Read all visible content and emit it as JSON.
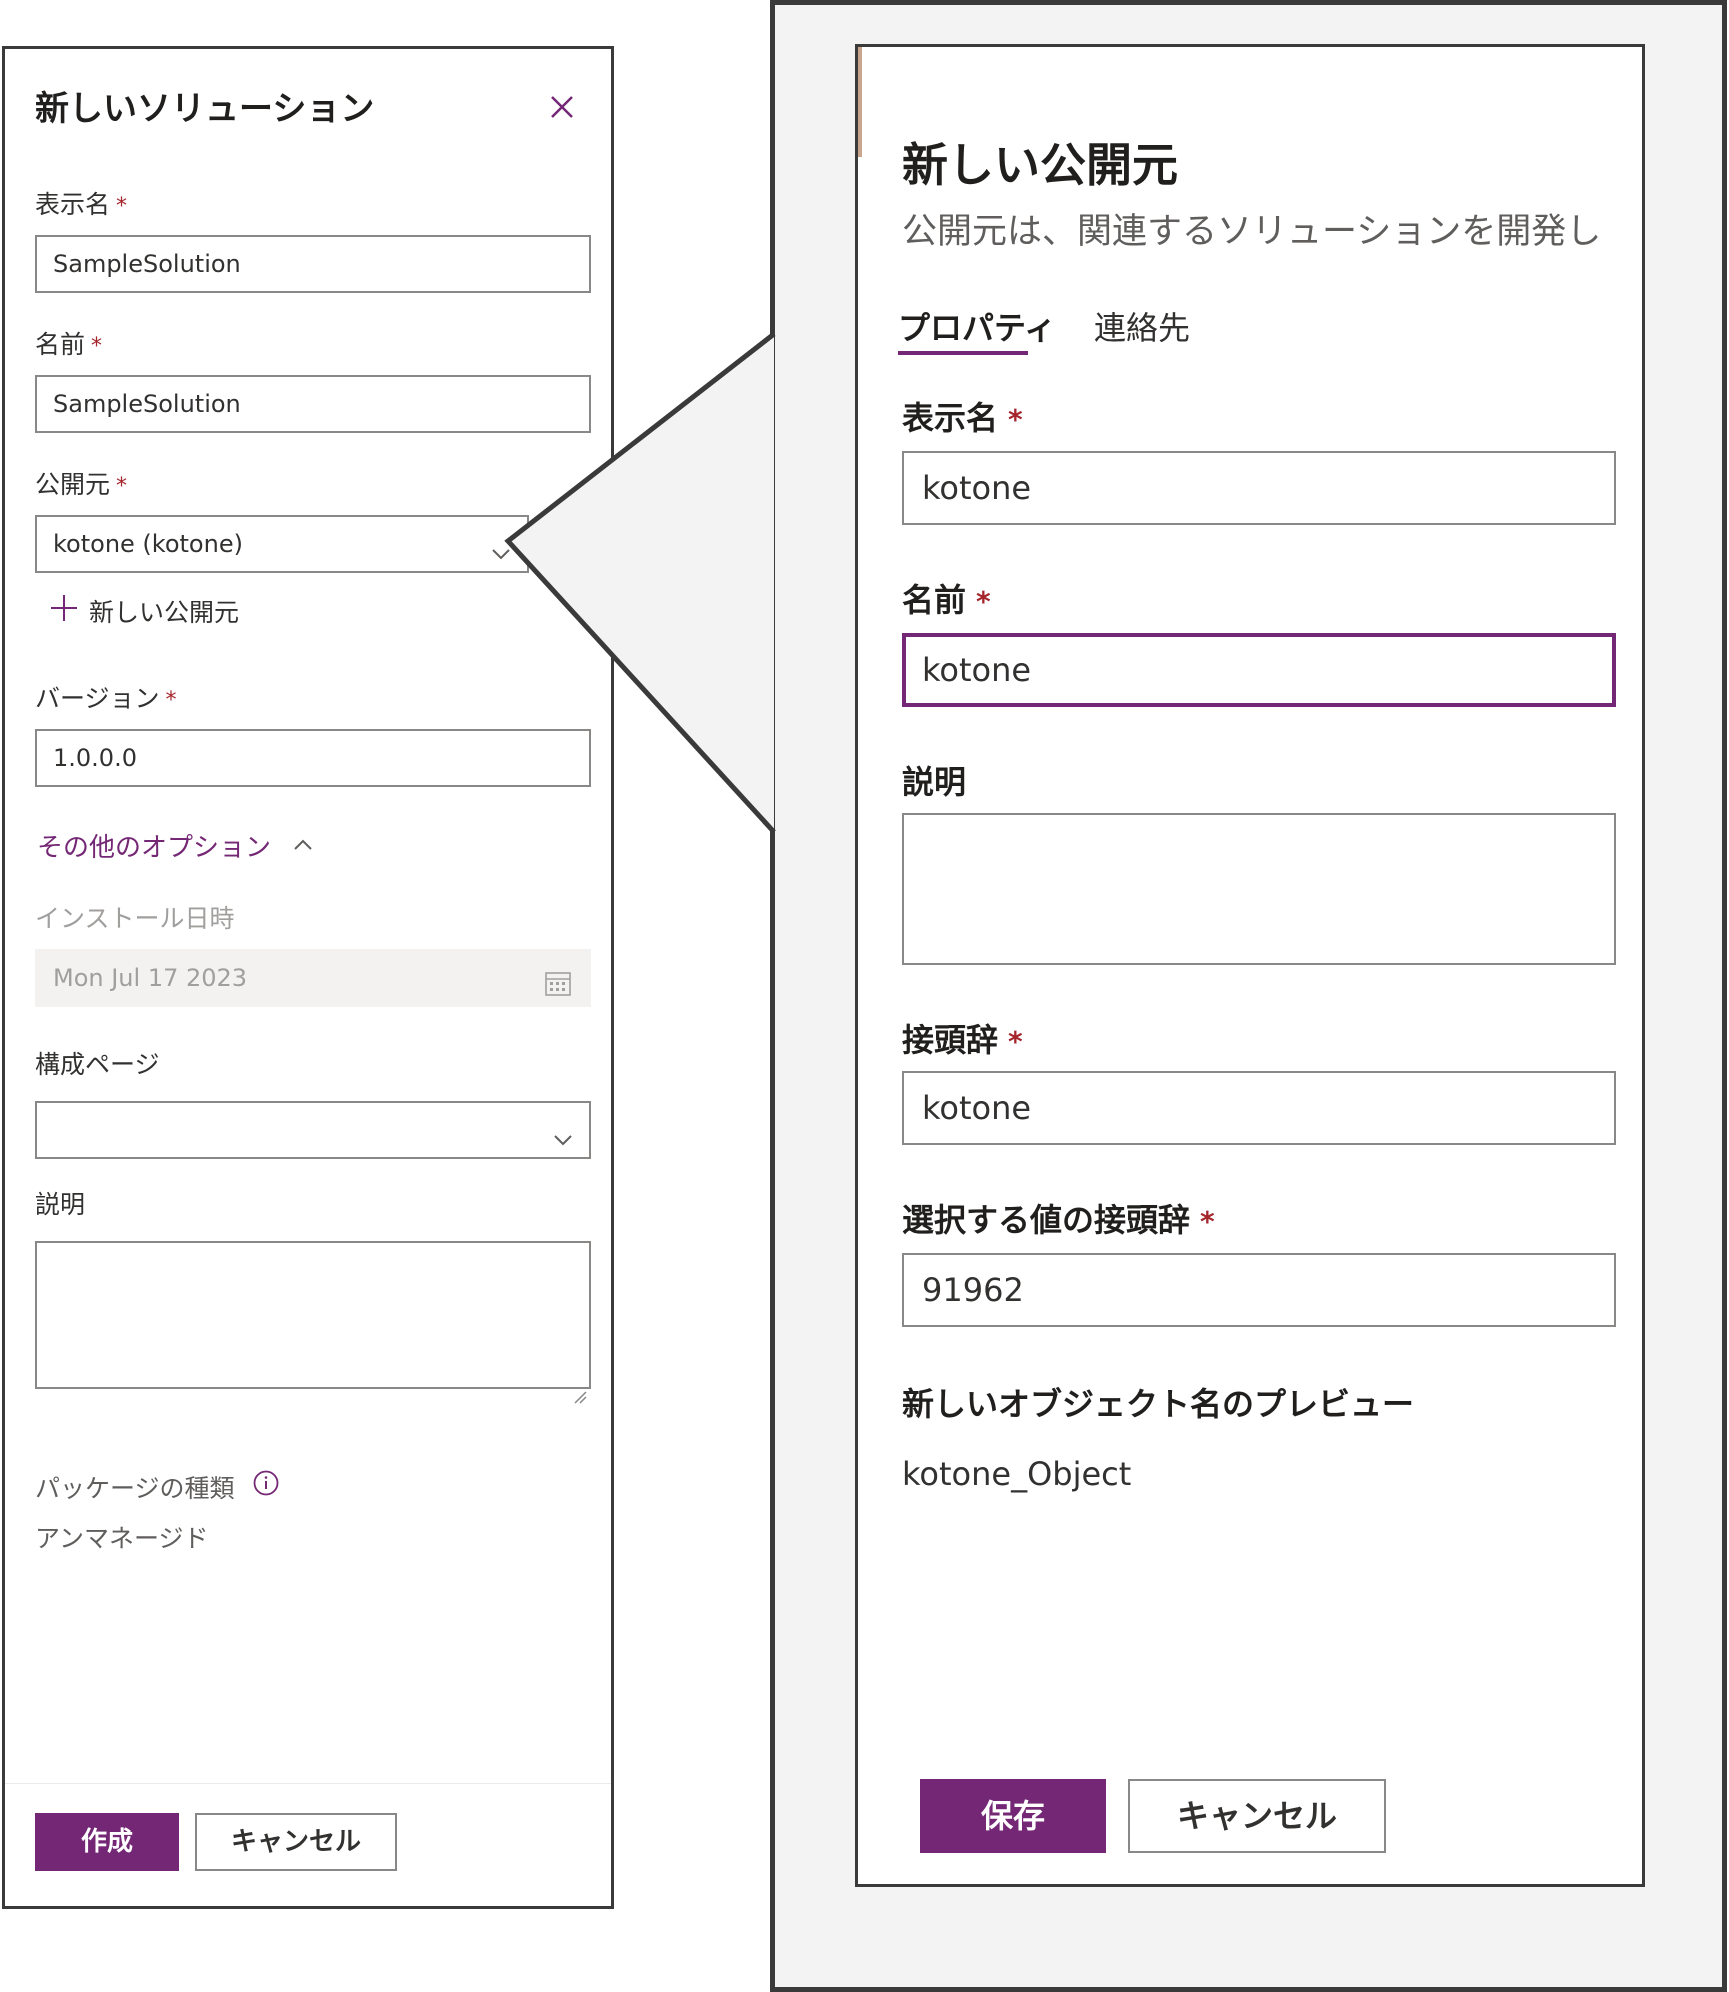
{
  "new_solution": {
    "title": "新しいソリューション",
    "display_name_label": "表示名",
    "display_name_value": "SampleSolution",
    "name_label": "名前",
    "name_value": "SampleSolution",
    "publisher_label": "公開元",
    "publisher_value": "kotone (kotone)",
    "new_publisher_link": "新しい公開元",
    "version_label": "バージョン",
    "version_value": "1.0.0.0",
    "more_options_label": "その他のオプション",
    "install_date_label": "インストール日時",
    "install_date_value": "Mon Jul 17 2023",
    "config_page_label": "構成ページ",
    "description_label": "説明",
    "package_type_label": "パッケージの種類",
    "package_type_value": "アンマネージド",
    "create_button": "作成",
    "cancel_button": "キャンセル",
    "required_marker": "*"
  },
  "new_publisher": {
    "title": "新しい公開元",
    "description": "公開元は、関連するソリューションを開発し",
    "tabs": [
      {
        "label": "プロパティ",
        "active": true
      },
      {
        "label": "連絡先",
        "active": false
      }
    ],
    "display_name_label": "表示名",
    "display_name_value": "kotone",
    "name_label": "名前",
    "name_value": "kotone",
    "description_label": "説明",
    "prefix_label": "接頭辞",
    "prefix_value": "kotone",
    "choice_prefix_label": "選択する値の接頭辞",
    "choice_prefix_value": "91962",
    "preview_label": "新しいオブジェクト名のプレビュー",
    "preview_value": "kotone_Object",
    "save_button": "保存",
    "cancel_button": "キャンセル",
    "required_marker": "*"
  },
  "colors": {
    "accent": "#742774",
    "required": "#a4262c",
    "border": "#8a8886",
    "frame": "#3a3a3a",
    "backdrop": "#f3f3f3"
  },
  "icons": [
    "close-icon",
    "chevron-down-icon",
    "add-icon",
    "chevron-up-icon",
    "calendar-icon",
    "info-icon",
    "resize-grip-icon"
  ]
}
